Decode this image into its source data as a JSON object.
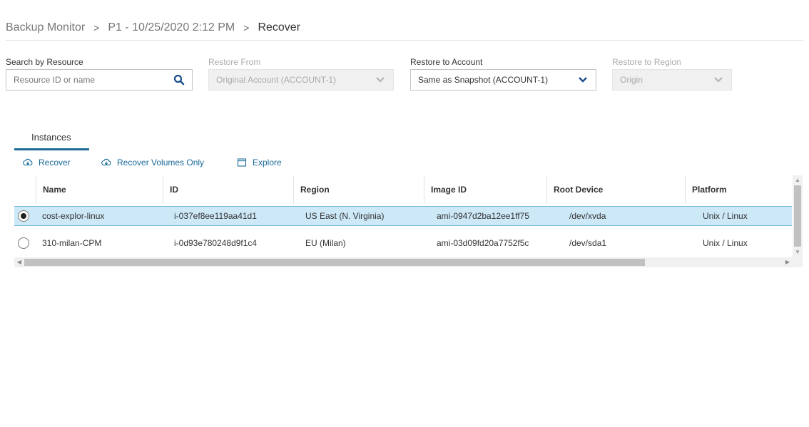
{
  "breadcrumb": {
    "items": [
      "Backup Monitor",
      "P1 - 10/25/2020 2:12 PM",
      "Recover"
    ],
    "separator": ">"
  },
  "filters": {
    "search": {
      "label": "Search by Resource",
      "placeholder": "Resource ID or name",
      "icon": "search-icon"
    },
    "restore_from": {
      "label": "Restore From",
      "value": "Original Account (ACCOUNT-1)",
      "disabled": true
    },
    "restore_to_account": {
      "label": "Restore to Account",
      "value": "Same as Snapshot (ACCOUNT-1)",
      "disabled": false
    },
    "restore_to_region": {
      "label": "Restore to Region",
      "value": "Origin",
      "disabled": true
    }
  },
  "tabs": [
    {
      "label": "Instances",
      "active": true
    }
  ],
  "actions": [
    {
      "label": "Recover",
      "icon": "cloud-download-icon"
    },
    {
      "label": "Recover Volumes Only",
      "icon": "cloud-download-icon"
    },
    {
      "label": "Explore",
      "icon": "window-icon"
    }
  ],
  "table": {
    "columns": [
      "Name",
      "ID",
      "Region",
      "Image ID",
      "Root Device",
      "Platform"
    ],
    "rows": [
      {
        "selected": true,
        "cells": [
          "cost-explor-linux",
          "i-037ef8ee119aa41d1",
          "US East (N. Virginia)",
          "ami-0947d2ba12ee1ff75",
          "/dev/xvda",
          "Unix / Linux"
        ]
      },
      {
        "selected": false,
        "cells": [
          "310-milan-CPM",
          "i-0d93e780248d9f1c4",
          "EU (Milan)",
          "ami-03d09fd20a7752f5c",
          "/dev/sda1",
          "Unix / Linux"
        ]
      }
    ]
  },
  "colors": {
    "accent": "#1a6a9a",
    "selected_row": "#cde8f7",
    "dropdown_chevron": "#1b4f8c"
  }
}
